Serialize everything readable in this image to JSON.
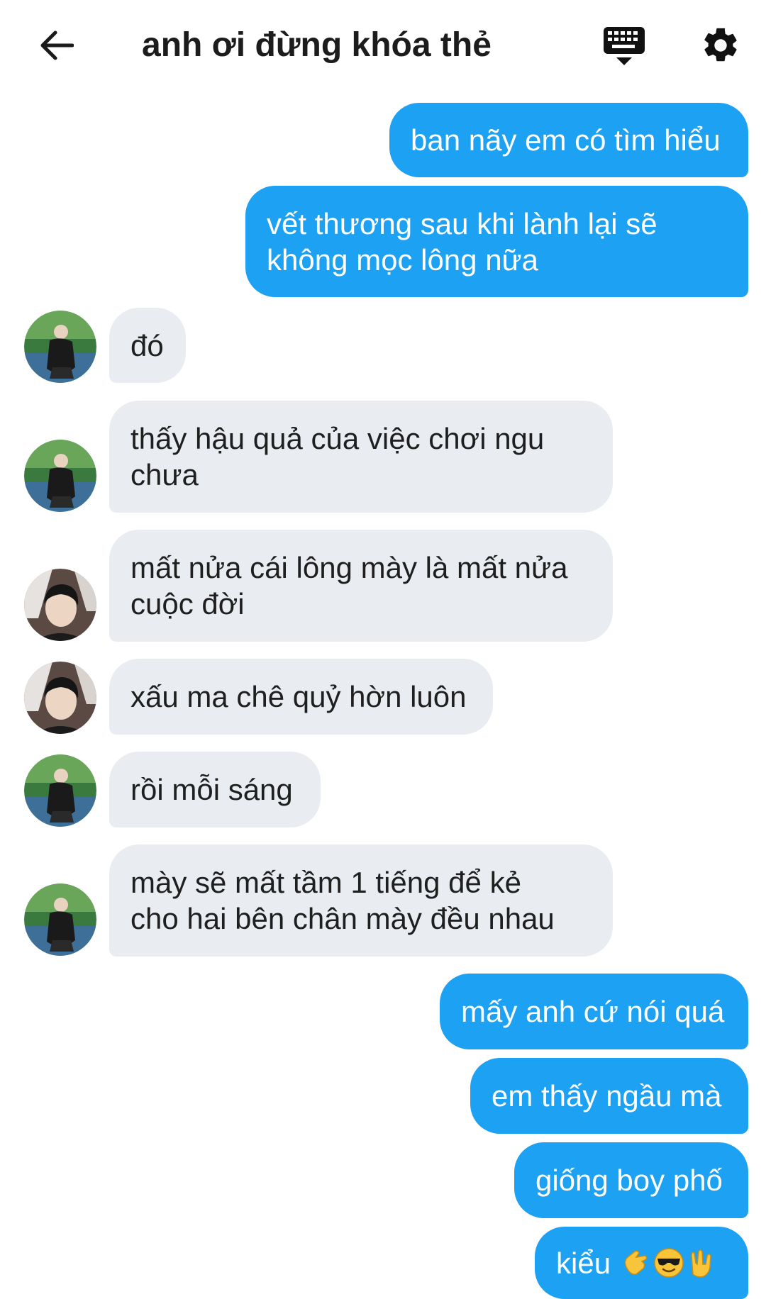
{
  "header": {
    "title": "anh ơi đừng khóa thẻ",
    "icons": {
      "back": "arrow-left-icon",
      "keyboard": "keyboard-icon",
      "settings": "gear-icon"
    }
  },
  "colors": {
    "outgoing_bubble": "#1da1f2",
    "incoming_bubble": "#e9edf2",
    "outgoing_text": "#ffffff",
    "incoming_text": "#1f1f1f"
  },
  "messages": [
    {
      "sender": "me",
      "text": "ban nãy em có tìm hiểu"
    },
    {
      "sender": "me",
      "text": "vết thương sau khi lành lại sẽ\nkhông mọc lông nữa"
    },
    {
      "sender": "friend-a",
      "text": "đó"
    },
    {
      "sender": "friend-a",
      "text": "thấy hậu quả của việc chơi ngu\nchưa"
    },
    {
      "sender": "friend-b",
      "text": "mất nửa cái lông mày là mất nửa\ncuộc đời"
    },
    {
      "sender": "friend-b",
      "text": "xấu ma chê quỷ hờn luôn"
    },
    {
      "sender": "friend-a",
      "text": "rồi mỗi sáng"
    },
    {
      "sender": "friend-a",
      "text": "mày sẽ mất tầm 1 tiếng để kẻ\ncho hai bên chân mày đều nhau"
    },
    {
      "sender": "me",
      "text": "mấy anh cứ nói quá"
    },
    {
      "sender": "me",
      "text": "em thấy ngầu mà"
    },
    {
      "sender": "me",
      "text": "giống boy phố"
    },
    {
      "sender": "me",
      "text": "kiểu",
      "emoji": [
        "call-me-hand",
        "sunglasses-face",
        "love-you-gesture"
      ]
    }
  ]
}
